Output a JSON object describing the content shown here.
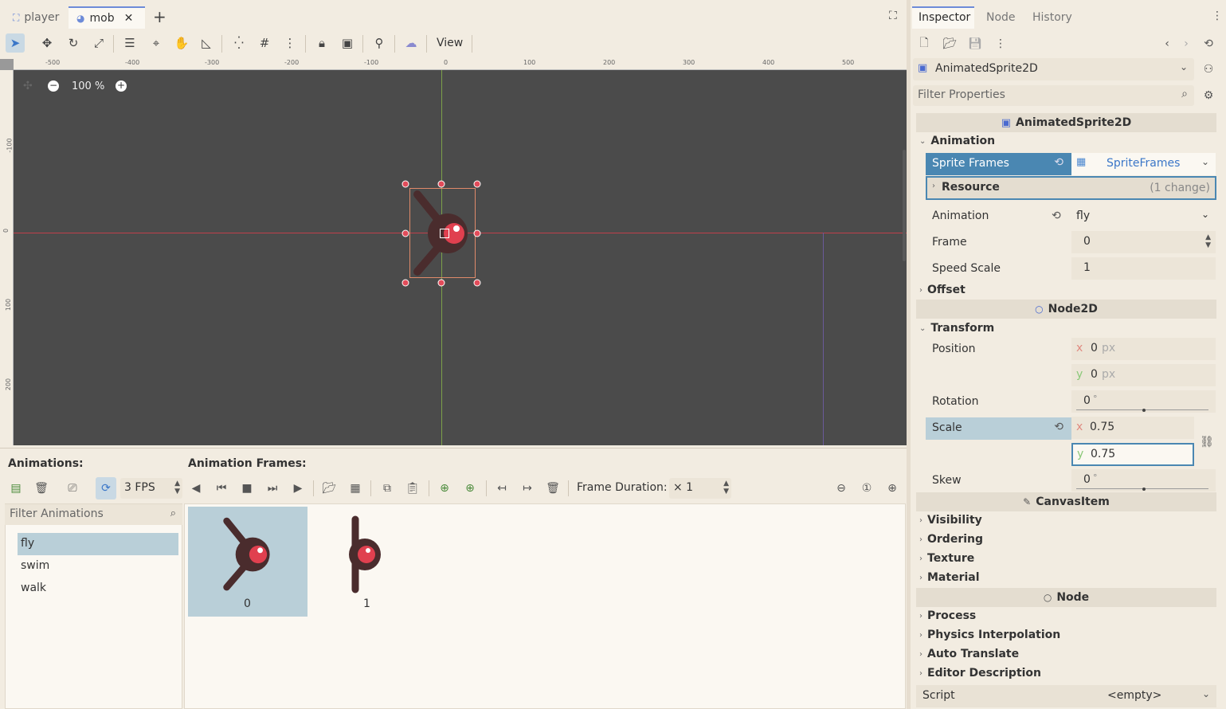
{
  "tabs": [
    {
      "label": "player",
      "icon": "node2d-scene-icon"
    },
    {
      "label": "mob",
      "icon": "scene-icon"
    }
  ],
  "toolbar": {
    "view_label": "View"
  },
  "viewport": {
    "zoom": "100 %",
    "ruler_h": [
      "-500",
      "-400",
      "-300",
      "-200",
      "-100",
      "0",
      "100",
      "200",
      "300",
      "400",
      "500"
    ],
    "ruler_v": [
      "-100",
      "0",
      "100",
      "200"
    ]
  },
  "inspector": {
    "tabs": [
      "Inspector",
      "Node",
      "History"
    ],
    "node_type": "AnimatedSprite2D",
    "filter_placeholder": "Filter Properties",
    "section_title": "AnimatedSprite2D",
    "animation_group": "Animation",
    "sprite_frames_label": "Sprite Frames",
    "sprite_frames_value": "SpriteFrames",
    "resource_label": "Resource",
    "resource_changes": "(1 change)",
    "animation_label": "Animation",
    "animation_value": "fly",
    "frame_label": "Frame",
    "frame_value": "0",
    "speed_label": "Speed Scale",
    "speed_value": "1",
    "offset_label": "Offset",
    "node2d_title": "Node2D",
    "transform_label": "Transform",
    "position_label": "Position",
    "pos_x_axis": "x",
    "pos_x": "0",
    "pos_y_axis": "y",
    "pos_y": "0",
    "px_unit": "px",
    "rotation_label": "Rotation",
    "rotation_value": "0",
    "deg_unit": "°",
    "scale_label": "Scale",
    "scale_x": "0.75",
    "scale_y": "0.75",
    "skew_label": "Skew",
    "skew_value": "0",
    "canvasitem_title": "CanvasItem",
    "visibility_label": "Visibility",
    "ordering_label": "Ordering",
    "texture_label": "Texture",
    "material_label": "Material",
    "node_title": "Node",
    "process_label": "Process",
    "physics_label": "Physics Interpolation",
    "autotranslate_label": "Auto Translate",
    "editordesc_label": "Editor Description",
    "script_label": "Script",
    "script_value": "<empty>"
  },
  "bottom": {
    "animations_title": "Animations:",
    "frames_title": "Animation Frames:",
    "fps_value": "3 FPS",
    "filter_placeholder": "Filter Animations",
    "animations": [
      "fly",
      "swim",
      "walk"
    ],
    "selected_animation": "fly",
    "frame_duration_label": "Frame Duration:",
    "frame_duration_value": "× 1",
    "frames": [
      "0",
      "1"
    ]
  },
  "colors": {
    "accent": "#6d8bd8",
    "selection": "#b9cfd8",
    "highlight_row": "#4a87b2",
    "mob_body": "#4a2c2d",
    "mob_eye": "#e0404f"
  }
}
